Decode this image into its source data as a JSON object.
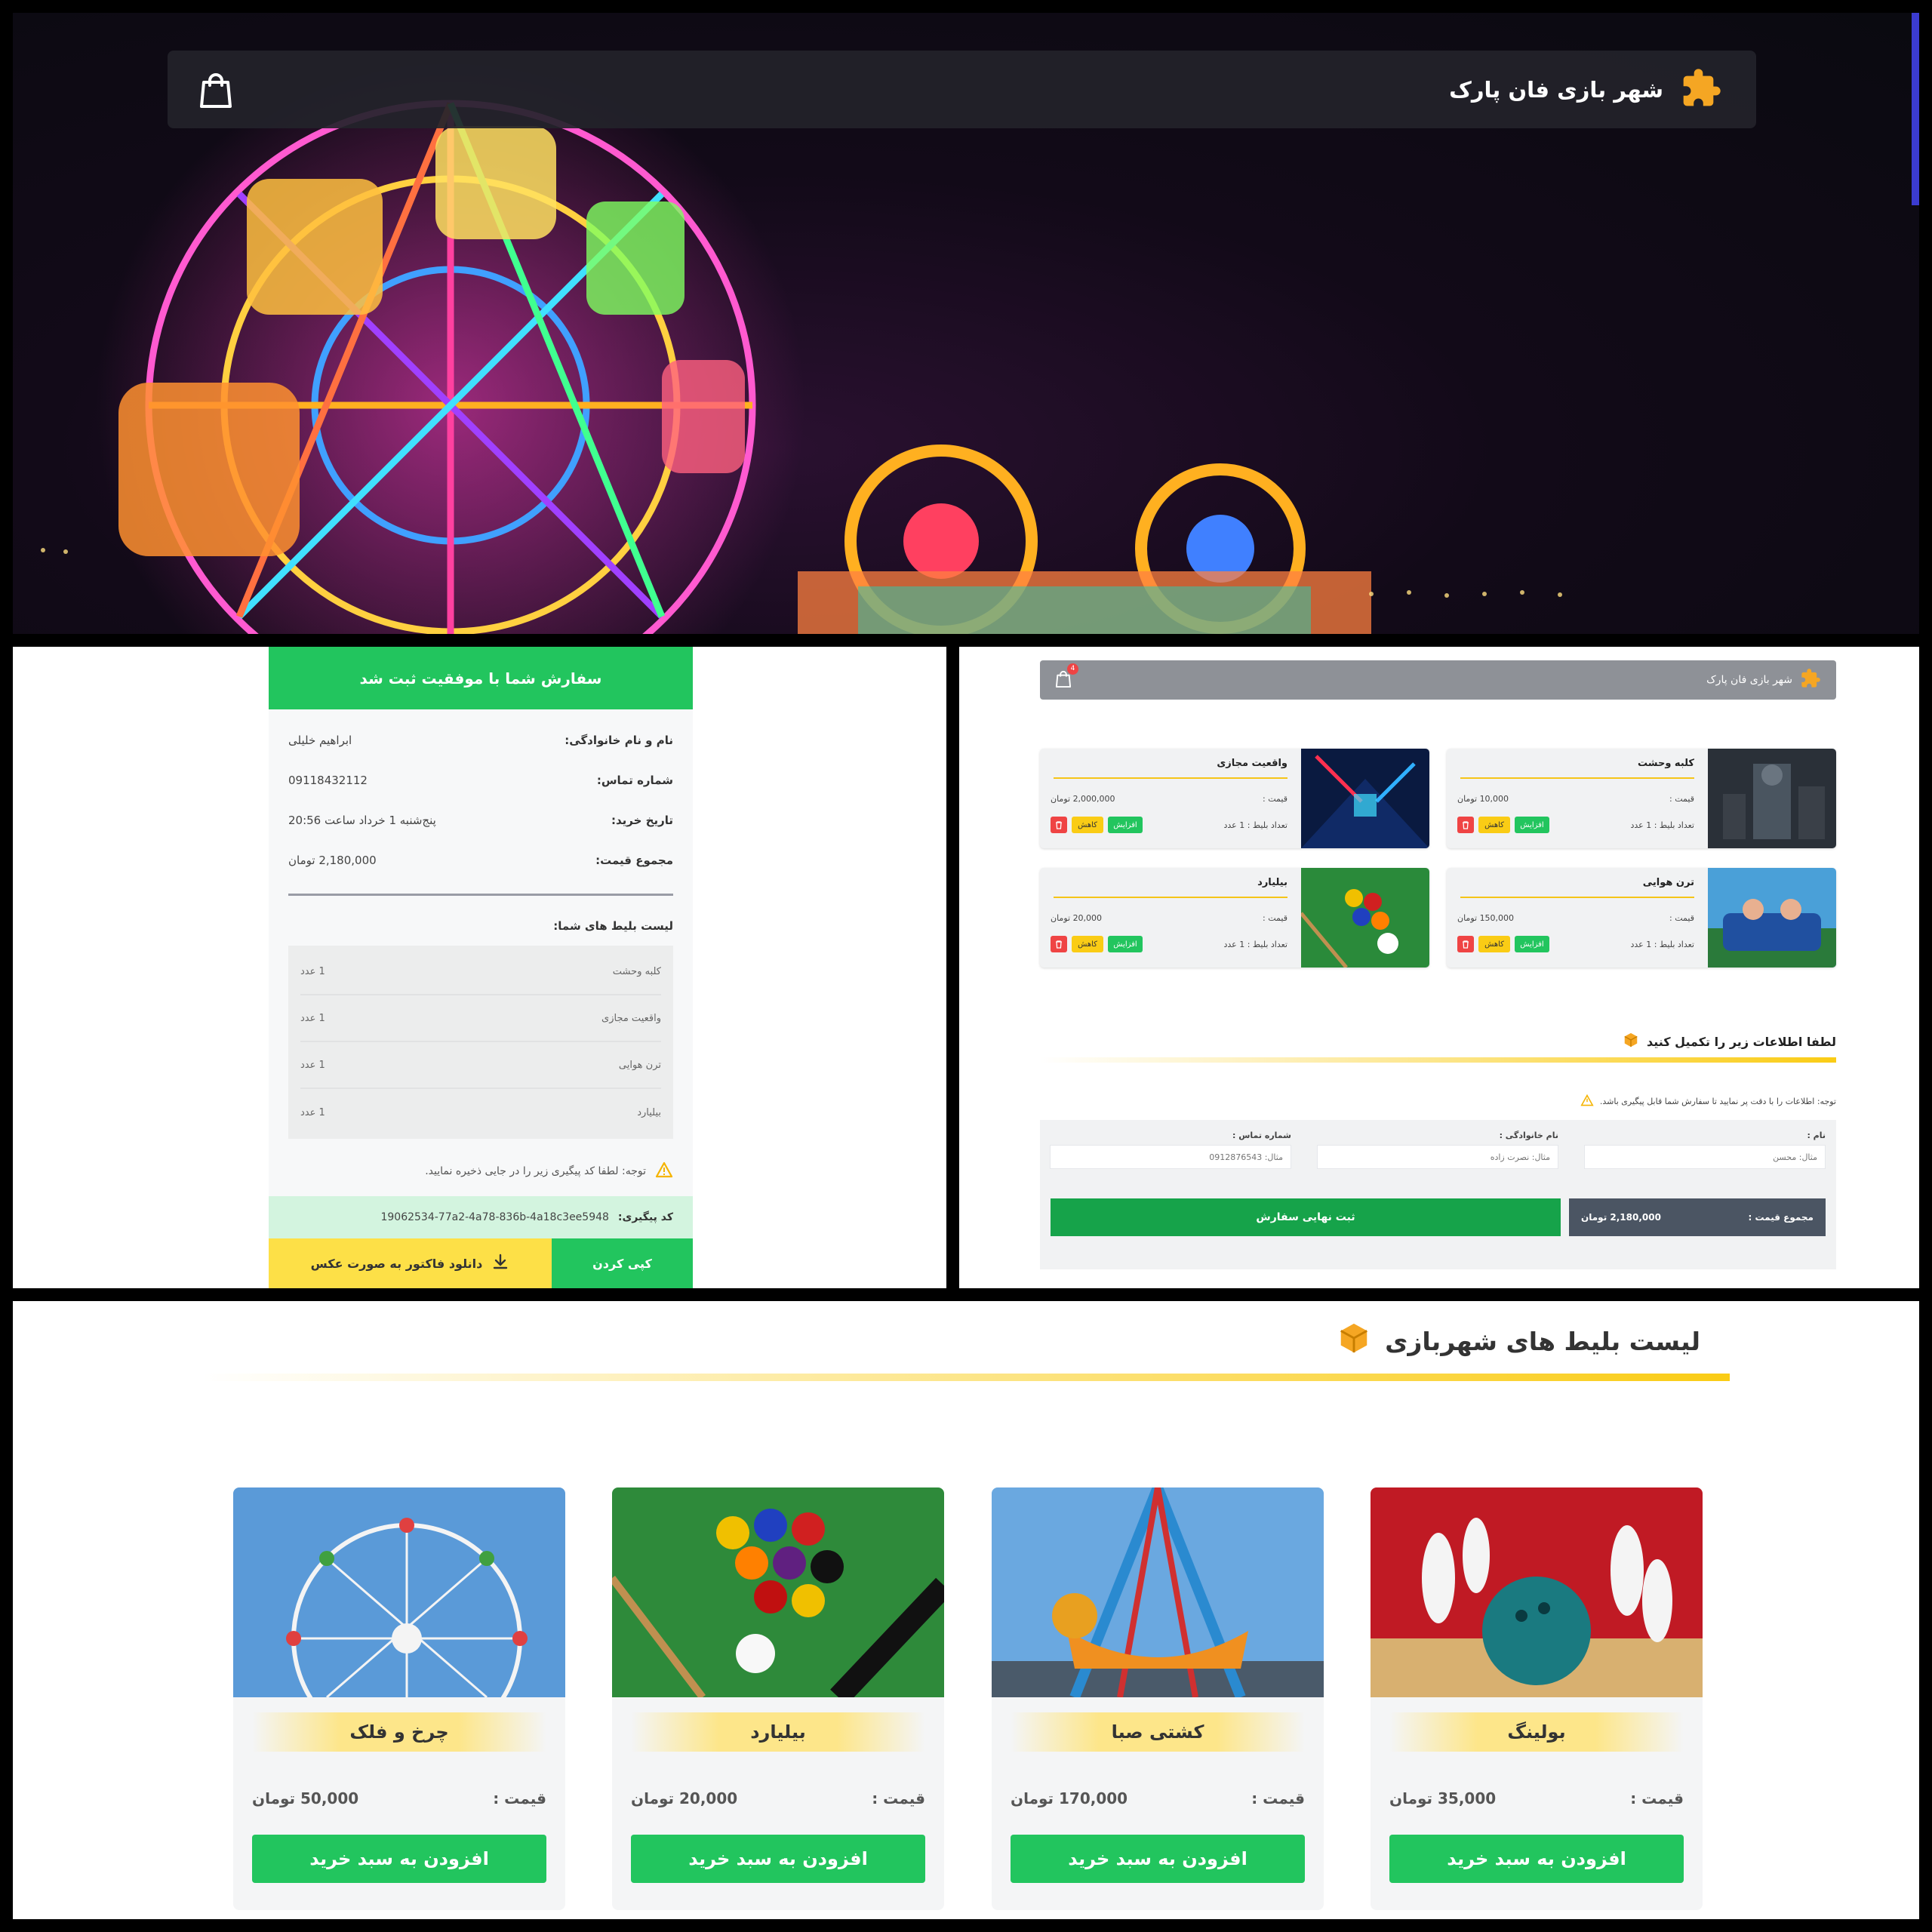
{
  "hero": {
    "brand": "شهر بازی فان پارک"
  },
  "receipt": {
    "header": "سفارش شما با موفقیت ثبت شد",
    "name_label": "نام و نام خانوادگی:",
    "name_value": "ابراهیم خلیلی",
    "phone_label": "شماره تماس:",
    "phone_value": "09118432112",
    "date_label": "تاریخ خرید:",
    "date_value": "پنج‌شنبه 1 خرداد ساعت 20:56",
    "total_label": "مجموع قیمت:",
    "total_value": "2,180,000 تومان",
    "list_title": "لیست بلیط های شما:",
    "items": [
      {
        "name": "کلبه وحشت",
        "qty": "1 عدد"
      },
      {
        "name": "واقعیت مجازی",
        "qty": "1 عدد"
      },
      {
        "name": "ترن هوایی",
        "qty": "1 عدد"
      },
      {
        "name": "بیلیارد",
        "qty": "1 عدد"
      }
    ],
    "note": "توجه: لطفا کد پیگیری زیر را در جایی ذخیره نمایید.",
    "tracking_label": "کد پیگیری:",
    "tracking_value": "19062534-77a2-4a78-836b-4a18c3ee5948",
    "copy_button": "کپی کردن",
    "download_button": "دانلود فاکتور به صورت عکس"
  },
  "cart": {
    "brand": "شهر بازی فان پارک",
    "badge": "4",
    "price_label": "قیمت :",
    "qty_label": "تعداد بلیط : 1 عدد",
    "inc": "افزایش",
    "dec": "کاهش",
    "items": [
      {
        "name": "کلبه وحشت",
        "price": "10,000 تومان"
      },
      {
        "name": "واقعیت مجازی",
        "price": "2,000,000 تومان"
      },
      {
        "name": "ترن هوایی",
        "price": "150,000 تومان"
      },
      {
        "name": "بیلیارد",
        "price": "20,000 تومان"
      }
    ],
    "form_title": "لطفا اطلاعات زیر را تکمیل کنید",
    "form_note": "توجه: اطلاعات را با دقت پر نمایید تا سفارش شما قابل پیگیری باشد.",
    "first_name_label": "نام :",
    "first_name_placeholder": "مثال: محسن",
    "last_name_label": "نام خانوادگی :",
    "last_name_placeholder": "مثال: نصرت زاده",
    "phone_label": "شماره تماس :",
    "phone_placeholder": "مثال: 0912876543",
    "total_label": "مجموع قیمت :",
    "total_value": "2,180,000 تومان",
    "submit": "ثبت نهایی سفارش"
  },
  "tickets": {
    "title": "لیست بلیط های شهربازی",
    "price_label": "قیمت :",
    "add_button": "افزودن به سبد خرید",
    "items": [
      {
        "name": "بولینگ",
        "price": "35,000 تومان"
      },
      {
        "name": "کشتی صبا",
        "price": "170,000 تومان"
      },
      {
        "name": "بیلیارد",
        "price": "20,000 تومان"
      },
      {
        "name": "چرخ و فلک",
        "price": "50,000 تومان"
      }
    ]
  },
  "colors": {
    "primary_green": "#22c55e",
    "accent_yellow": "#facc15",
    "danger_red": "#ef4444"
  }
}
